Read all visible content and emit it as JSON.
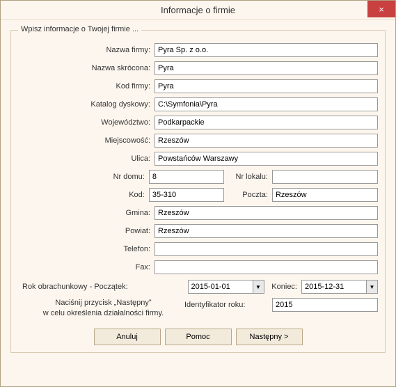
{
  "window": {
    "title": "Informacje o firmie",
    "close": "×"
  },
  "group": {
    "legend": "Wpisz informacje o Twojej firmie ..."
  },
  "labels": {
    "companyName": "Nazwa firmy:",
    "shortName": "Nazwa skrócona:",
    "companyCode": "Kod firmy:",
    "diskCatalog": "Katalog dyskowy:",
    "province": "Województwo:",
    "locality": "Miejscowość:",
    "street": "Ulica:",
    "houseNo": "Nr domu:",
    "unitNo": "Nr lokalu:",
    "postalCode": "Kod:",
    "post": "Poczta:",
    "commune": "Gmina:",
    "county": "Powiat:",
    "phone": "Telefon:",
    "fax": "Fax:",
    "fiscalYearStart": "Rok obrachunkowy - Początek:",
    "fiscalYearEnd": "Koniec:",
    "yearId": "Identyfikator roku:"
  },
  "values": {
    "companyName": "Pyra Sp. z o.o.",
    "shortName": "Pyra",
    "companyCode": "Pyra",
    "diskCatalog": "C:\\Symfonia\\Pyra",
    "province": "Podkarpackie",
    "locality": "Rzeszów",
    "street": "Powstańców Warszawy",
    "houseNo": "8",
    "unitNo": "",
    "postalCode": "35-310",
    "post": "Rzeszów",
    "commune": "Rzeszów",
    "county": "Rzeszów",
    "phone": "",
    "fax": "",
    "fiscalYearStart": "2015-01-01",
    "fiscalYearEnd": "2015-12-31",
    "yearId": "2015"
  },
  "hint": {
    "line1": "Naciśnij przycisk „Następny”",
    "line2": "w celu określenia działalności firmy."
  },
  "buttons": {
    "cancel": "Anuluj",
    "help": "Pomoc",
    "next": "Następny >"
  },
  "icons": {
    "dropdown": "▼"
  }
}
